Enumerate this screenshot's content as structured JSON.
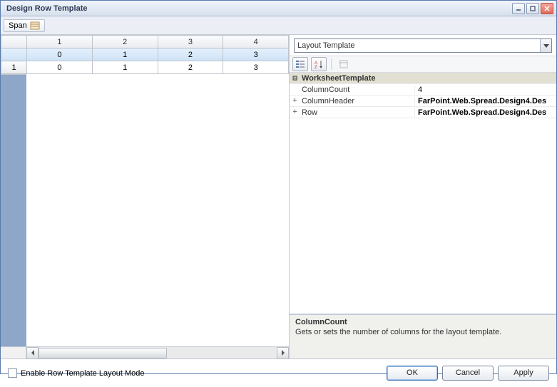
{
  "window": {
    "title": "Design Row Template"
  },
  "toolbar": {
    "span_label": "Span"
  },
  "grid": {
    "col_headers": [
      "1",
      "2",
      "3",
      "4"
    ],
    "sub_headers": [
      "0",
      "1",
      "2",
      "3"
    ],
    "rows": [
      {
        "head": "1",
        "cells": [
          "0",
          "1",
          "2",
          "3"
        ]
      }
    ]
  },
  "dropdown": {
    "selected": "Layout Template"
  },
  "propgrid": {
    "category": "WorksheetTemplate",
    "rows": [
      {
        "name": "ColumnCount",
        "value": "4",
        "expand": "",
        "bold": false
      },
      {
        "name": "ColumnHeader",
        "value": "FarPoint.Web.Spread.Design4.Des",
        "expand": "+",
        "bold": true
      },
      {
        "name": "Row",
        "value": "FarPoint.Web.Spread.Design4.Des",
        "expand": "+",
        "bold": true
      }
    ]
  },
  "description": {
    "title": "ColumnCount",
    "text": "Gets or sets the number of columns for the layout template."
  },
  "bottom": {
    "checkbox_label": "Enable Row Template Layout Mode",
    "ok": "OK",
    "cancel": "Cancel",
    "apply": "Apply"
  }
}
